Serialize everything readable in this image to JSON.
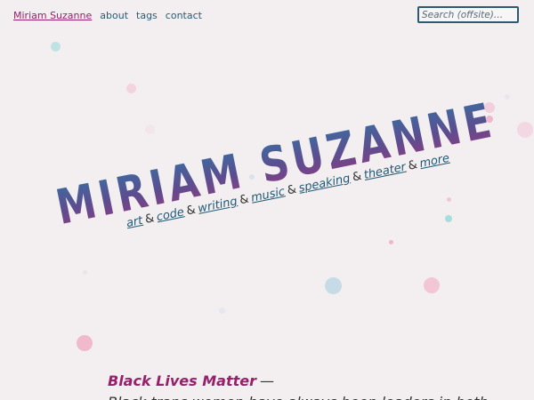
{
  "nav": {
    "home": "Miriam Suzanne",
    "items": [
      "about",
      "tags",
      "contact"
    ]
  },
  "search": {
    "placeholder": "Search (offsite)…"
  },
  "banner": {
    "title": "MIRIAM SUZANNE",
    "links": [
      "art",
      "code",
      "writing",
      "music",
      "speaking",
      "theater",
      "more"
    ],
    "separator": "&"
  },
  "statement": {
    "headline": "Black Lives Matter",
    "dash": "—",
    "text": "Black trans women have always been leaders in both"
  },
  "colors": {
    "background": "#f3eff1",
    "accent": "#96206a",
    "link": "#1f5a75",
    "title_gradient_top": "#3e6aa0",
    "title_gradient_bottom": "#8a3e82"
  }
}
